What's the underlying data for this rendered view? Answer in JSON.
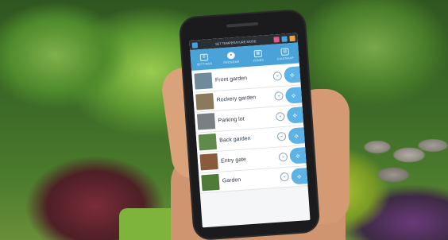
{
  "statusbar": {
    "app_text": "SET TEMPERATURE MODE",
    "icons": [
      "menu-icon",
      "alarm-icon",
      "snowflake-icon"
    ]
  },
  "navbar": {
    "items": [
      {
        "label": "SETTINGS",
        "icon": "gear-icon",
        "active": false
      },
      {
        "label": "PROGRAM",
        "icon": "drop-icon",
        "active": true
      },
      {
        "label": "ZONES",
        "icon": "map-icon",
        "active": false
      },
      {
        "label": "CALENDAR",
        "icon": "calendar-icon",
        "active": false
      }
    ]
  },
  "zones": [
    {
      "name": "Front garden",
      "thumb_color": "#6f8a9a"
    },
    {
      "name": "Rockery garden",
      "thumb_color": "#8a7a5c"
    },
    {
      "name": "Parking lot",
      "thumb_color": "#7a7f84"
    },
    {
      "name": "Back garden",
      "thumb_color": "#5f8a4a"
    },
    {
      "name": "Entry gate",
      "thumb_color": "#8a5a3c"
    },
    {
      "name": "Garden",
      "thumb_color": "#4f7a3a"
    }
  ],
  "colors": {
    "accent": "#4aa3d8",
    "water_button": "#5db3e6"
  }
}
